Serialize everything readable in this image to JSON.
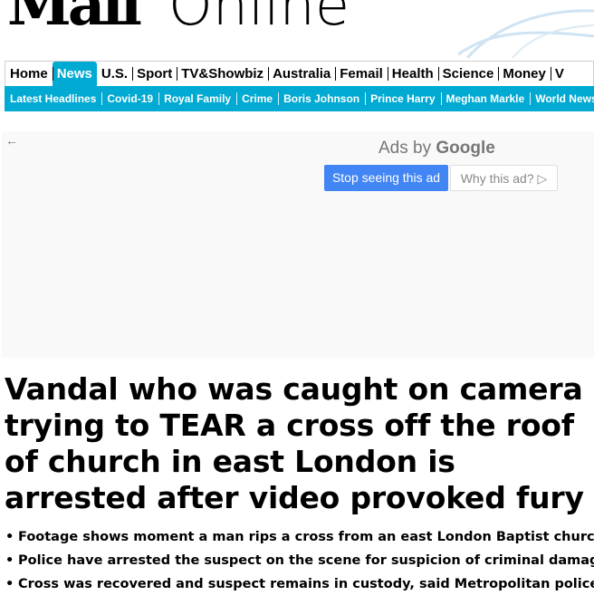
{
  "masthead": {
    "logo_part1": "Mail",
    "logo_part2": "Online"
  },
  "nav": {
    "items": [
      "Home",
      "News",
      "U.S.",
      "Sport",
      "TV&Showbiz",
      "Australia",
      "Femail",
      "Health",
      "Science",
      "Money",
      "V"
    ],
    "active": "News",
    "active_color": "#00aad2"
  },
  "subnav": {
    "items": [
      "Latest Headlines",
      "Covid-19",
      "Royal Family",
      "Crime",
      "Boris Johnson",
      "Prince Harry",
      "Meghan Markle",
      "World News"
    ]
  },
  "ad": {
    "back_arrow": "←",
    "ads_by_prefix": "Ads by",
    "ads_by_brand": "Google",
    "stop_label": "Stop seeing this ad",
    "why_label": "Why this ad? ▷"
  },
  "article": {
    "headline": "Vandal who was caught on camera trying to TEAR a cross off the roof of church in east London is arrested after video provoked fury",
    "bullets": [
      "Footage shows moment a man rips a cross from an east London Baptist church",
      "Police have arrested the suspect on the scene for suspicion of criminal damage",
      "Cross was recovered and suspect remains in custody, said Metropolitan police"
    ]
  }
}
